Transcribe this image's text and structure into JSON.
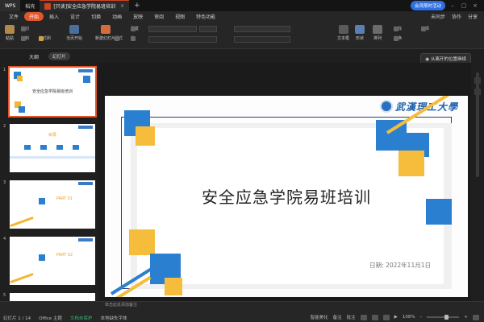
{
  "titlebar": {
    "tabs": [
      {
        "label": "WPS",
        "type": "wps"
      },
      {
        "label": "稻壳",
        "type": "plain"
      },
      {
        "label": "[只读]安全应急学院易班培训",
        "type": "doc"
      }
    ],
    "add_label": "+",
    "login_label": "会员限时活动"
  },
  "menu": {
    "file_label": "文件",
    "items": [
      "开始",
      "插入",
      "设计",
      "切换",
      "动画",
      "放映",
      "审阅",
      "视图",
      "特色功能"
    ],
    "active": "开始",
    "right": [
      "未同步",
      "协作",
      "分享"
    ]
  },
  "ribbon": {
    "paste_label": "粘贴",
    "cut_label": "剪切",
    "copy_label": "复制",
    "format_painter_label": "格式刷",
    "play_label": "当页开始",
    "new_slide_label": "新建幻灯片",
    "layout_label": "版式",
    "section_label": "节",
    "reset_label": "重置",
    "textbox_label": "文本框",
    "shape_label": "形状",
    "arrange_label": "排列",
    "find_label": "查找",
    "replace_label": "替换",
    "select_label": "选择"
  },
  "subbar": {
    "outline_tab": "大纲",
    "slide_tab": "幻灯片",
    "locate_label": "从离开的位置继续"
  },
  "thumbnails": [
    {
      "num": "1",
      "title": "安全应急学院易班培训",
      "selected": true
    },
    {
      "num": "2",
      "title": "目录",
      "selected": false
    },
    {
      "num": "3",
      "title": "PART 01",
      "selected": false
    },
    {
      "num": "4",
      "title": "PART 02",
      "selected": false
    },
    {
      "num": "5",
      "title": "",
      "selected": false
    }
  ],
  "slide": {
    "title": "安全应急学院易班培训",
    "date": "日期: 2022年11月1日",
    "logo_text": "武漢理工大學",
    "colors": {
      "blue": "#2a7fd0",
      "yellow": "#f6bd3c",
      "navy": "#2b3d7a"
    }
  },
  "notes_placeholder": "单击此处添加备注",
  "status": {
    "slide_counter": "幻灯片 1 / 14",
    "theme": "Office 主题",
    "protect": "文档未保护",
    "font_missing": "本地缺失字体",
    "beautify_label": "智能美化",
    "notes_label": "备注",
    "comment_label": "批注",
    "zoom": "108%"
  }
}
